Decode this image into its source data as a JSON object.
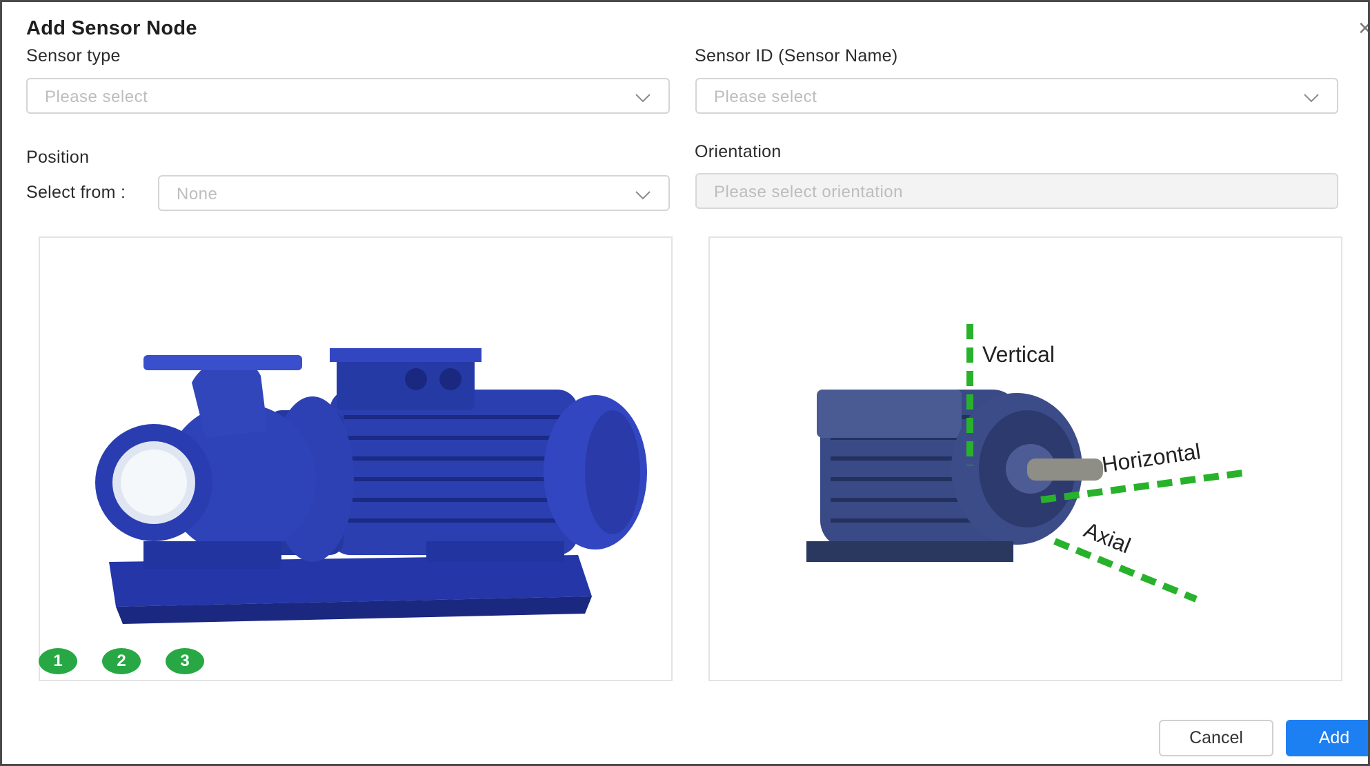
{
  "dialog": {
    "title": "Add Sensor Node",
    "close_symbol": "×"
  },
  "form": {
    "sensor_type": {
      "label": "Sensor type",
      "placeholder": "Please select"
    },
    "sensor_id": {
      "label": "Sensor ID (Sensor Name)",
      "placeholder": "Please select"
    },
    "position": {
      "label": "Position",
      "select_from_label": "Select from :",
      "value": "None"
    },
    "orientation": {
      "label": "Orientation",
      "placeholder": "Please select orientation"
    }
  },
  "position_markers": [
    "1",
    "2",
    "3"
  ],
  "orientation_axes": {
    "vertical": "Vertical",
    "horizontal": "Horizontal",
    "axial": "Axial"
  },
  "colors": {
    "marker_green": "#27a844",
    "axis_green": "#28b22c",
    "primary_blue": "#1c7ff2",
    "pump_blue": "#2c3fb0"
  },
  "buttons": {
    "cancel": "Cancel",
    "add": "Add"
  }
}
